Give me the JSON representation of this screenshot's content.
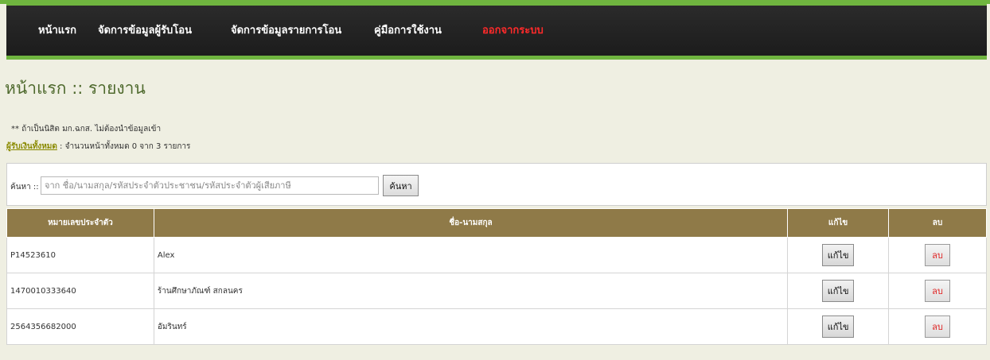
{
  "nav": {
    "items": [
      {
        "label": "หน้าแรก"
      },
      {
        "label": "จัดการข้อมูลผู้รับโอน"
      },
      {
        "label": "จัดการข้อมูลรายการโอน"
      },
      {
        "label": "คู่มือการใช้งาน"
      },
      {
        "label": "ออกจากระบบ"
      }
    ],
    "accent_color": "#6fb53f",
    "logout_color": "#ff2a2a"
  },
  "page": {
    "title": "หน้าแรก :: รายงาน",
    "note": "** ถ้าเป็นนิสิต มก.ฉกส. ไม่ต้องนำข้อมูลเข้า",
    "summary_link": "ผู้รับเงินทั้งหมด",
    "summary_text": " : จำนวนหน้าทั้งหมด 0 จาก 3 รายการ"
  },
  "search": {
    "label": "ค้นหา :: ",
    "placeholder": "จาก ชื่อ/นามสกุล/รหัสประจำตัวประชาชน/รหัสประจำตัวผู้เสียภาษี",
    "button_label": "ค้นหา"
  },
  "table": {
    "header_color": "#8f7a48",
    "columns": [
      "หมายเลขประจำตัว",
      "ชื่อ-นามสกุล",
      "แก้ไข",
      "ลบ"
    ],
    "rows": [
      {
        "id": "P14523610",
        "name": "Alex",
        "edit_label": "แก้ไข",
        "delete_label": "ลบ"
      },
      {
        "id": "1470010333640",
        "name": "ร้านศึกษาภัณฑ์ สกลนคร",
        "edit_label": "แก้ไข",
        "delete_label": "ลบ"
      },
      {
        "id": "2564356682000",
        "name": "อัมรินทร์",
        "edit_label": "แก้ไข",
        "delete_label": "ลบ"
      }
    ]
  }
}
